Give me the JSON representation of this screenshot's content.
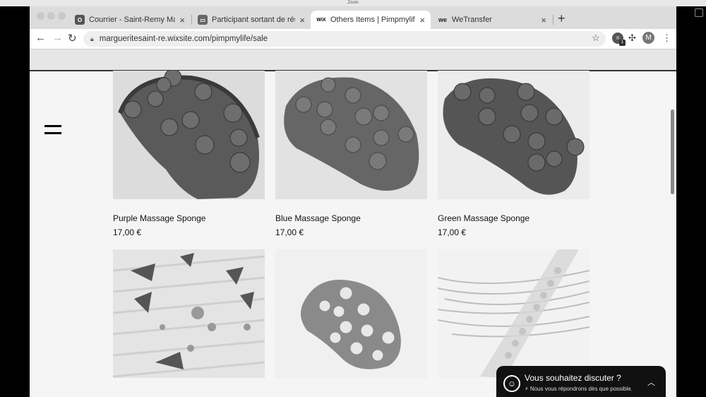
{
  "window": {
    "title": "Zoom"
  },
  "tabs": [
    {
      "label": "Courrier - Saint-Remy Margue",
      "icon": "outlook-icon"
    },
    {
      "label": "Participant sortant de réunion",
      "icon": "zoom-icon"
    },
    {
      "label": "Others Items | Pimpmylife",
      "icon": "wix-icon",
      "favicon_text": "WiX"
    },
    {
      "label": "WeTransfer",
      "icon": "wetransfer-icon",
      "favicon_text": "we"
    }
  ],
  "toolbar": {
    "url": "margueritesaint-re.wixsite.com/pimpmylife/sale",
    "avatar_initial": "M",
    "extension_count": "1"
  },
  "products": [
    {
      "name": "Purple Massage Sponge",
      "price": "17,00 €"
    },
    {
      "name": "Blue Massage Sponge",
      "price": "17,00 €"
    },
    {
      "name": "Green Massage Sponge",
      "price": "17,00 €"
    },
    {
      "name": "",
      "price": ""
    },
    {
      "name": "",
      "price": ""
    },
    {
      "name": "",
      "price": ""
    }
  ],
  "chat": {
    "title": "Vous souhaitez discuter ?",
    "subtitle": "Nous vous répondrons dès que possible."
  }
}
